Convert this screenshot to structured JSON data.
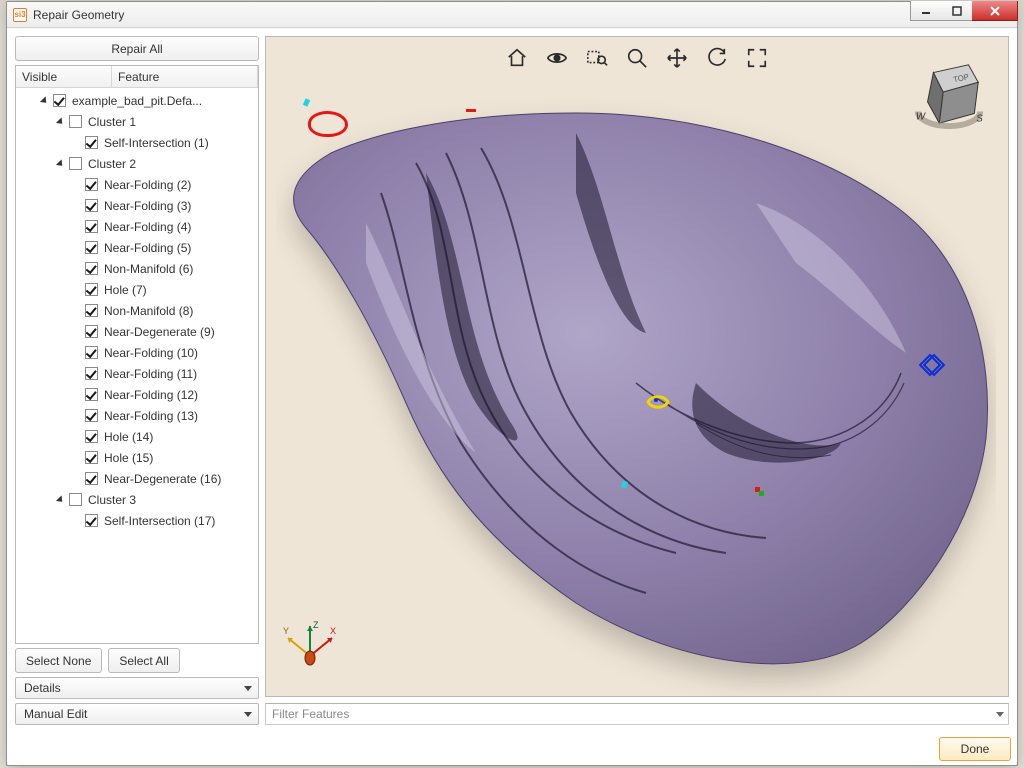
{
  "window": {
    "title": "Repair Geometry"
  },
  "left": {
    "repair_all": "Repair All",
    "columns": {
      "visible": "Visible",
      "feature": "Feature"
    },
    "root": {
      "label": "example_bad_pit.Defa...",
      "checked": true
    },
    "clusters": [
      {
        "label": "Cluster 1",
        "checked": false,
        "items": [
          {
            "label": "Self-Intersection (1)",
            "checked": true
          }
        ]
      },
      {
        "label": "Cluster 2",
        "checked": false,
        "items": [
          {
            "label": "Near-Folding (2)",
            "checked": true
          },
          {
            "label": "Near-Folding (3)",
            "checked": true
          },
          {
            "label": "Near-Folding (4)",
            "checked": true
          },
          {
            "label": "Near-Folding (5)",
            "checked": true
          },
          {
            "label": "Non-Manifold (6)",
            "checked": true
          },
          {
            "label": "Hole (7)",
            "checked": true
          },
          {
            "label": "Non-Manifold (8)",
            "checked": true
          },
          {
            "label": "Near-Degenerate (9)",
            "checked": true
          },
          {
            "label": "Near-Folding (10)",
            "checked": true
          },
          {
            "label": "Near-Folding (11)",
            "checked": true
          },
          {
            "label": "Near-Folding (12)",
            "checked": true
          },
          {
            "label": "Near-Folding (13)",
            "checked": true
          },
          {
            "label": "Hole (14)",
            "checked": true
          },
          {
            "label": "Hole (15)",
            "checked": true
          },
          {
            "label": "Near-Degenerate (16)",
            "checked": true
          }
        ]
      },
      {
        "label": "Cluster 3",
        "checked": false,
        "items": [
          {
            "label": "Self-Intersection (17)",
            "checked": true
          }
        ]
      }
    ],
    "select_none": "Select None",
    "select_all": "Select All",
    "combo1": "Details",
    "combo2": "Manual Edit"
  },
  "right": {
    "filter_placeholder": "Filter Features",
    "done": "Done",
    "toolbar_icons": [
      "home-icon",
      "eye-icon",
      "zoom-box-icon",
      "zoom-icon",
      "pan-icon",
      "rotate-icon",
      "fullscreen-icon"
    ],
    "compass": {
      "face": "TOP",
      "w": "W",
      "s": "S"
    }
  }
}
